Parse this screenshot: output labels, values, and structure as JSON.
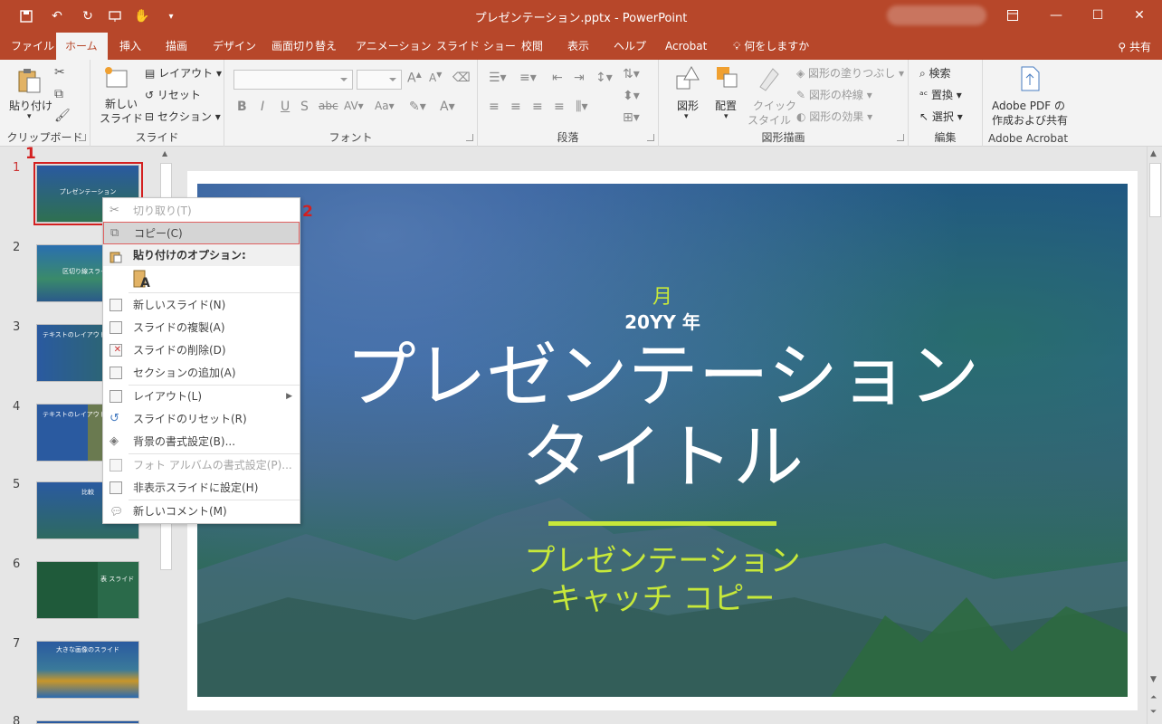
{
  "titlebar": {
    "title": "プレゼンテーション.pptx  -  PowerPoint",
    "quick_access": [
      "save-icon",
      "undo-icon",
      "redo-icon",
      "present-icon",
      "touch-mode-icon",
      "customize-icon"
    ],
    "window_buttons": [
      "ribbon-display-icon",
      "minimize-icon",
      "maximize-icon",
      "close-icon"
    ]
  },
  "tabs": {
    "items": [
      "ファイル",
      "ホーム",
      "挿入",
      "描画",
      "デザイン",
      "画面切り替え",
      "アニメーション",
      "スライド ショー",
      "校閲",
      "表示",
      "ヘルプ",
      "Acrobat"
    ],
    "active": "ホーム",
    "tell_me": "何をしますか",
    "share": "共有"
  },
  "ribbon": {
    "clipboard": {
      "label": "クリップボード",
      "paste": "貼り付け"
    },
    "slides": {
      "label": "スライド",
      "new_slide_1": "新しい",
      "new_slide_2": "スライド",
      "layout": "レイアウト",
      "reset": "リセット",
      "section": "セクション"
    },
    "font": {
      "label": "フォント",
      "bold": "B",
      "italic": "I",
      "underline": "U",
      "strike": "S",
      "shadow": "abc"
    },
    "paragraph": {
      "label": "段落"
    },
    "drawing": {
      "label": "図形描画",
      "shapes": "図形",
      "arrange": "配置",
      "quick_style_1": "クイック",
      "quick_style_2": "スタイル",
      "fill": "図形の塗りつぶし",
      "outline": "図形の枠線",
      "effect": "図形の効果"
    },
    "editing": {
      "label": "編集",
      "find": "検索",
      "replace": "置換",
      "select": "選択"
    },
    "acrobat": {
      "label": "Adobe Acrobat",
      "btn_1": "Adobe PDF の",
      "btn_2": "作成および共有"
    }
  },
  "thumbnails": [
    {
      "num": "1",
      "title": "プレゼンテーション"
    },
    {
      "num": "2",
      "title": "区切り線スライド"
    },
    {
      "num": "3",
      "title": "テキストのレイアウト 1"
    },
    {
      "num": "4",
      "title": "テキストのレイアウト 2"
    },
    {
      "num": "5",
      "title": "比較"
    },
    {
      "num": "6",
      "title": "表 スライド"
    },
    {
      "num": "7",
      "title": "大きな画像のスライド"
    },
    {
      "num": "8",
      "title": ""
    }
  ],
  "slide": {
    "month": "月",
    "year": "20YY 年",
    "title_line1": "プレゼンテーション",
    "title_line2": "タイトル",
    "sub_line1": "プレゼンテーション",
    "sub_line2": "キャッチ コピー"
  },
  "context_menu": {
    "cut": "切り取り(T)",
    "copy": "コピー(C)",
    "paste_header": "貼り付けのオプション:",
    "paste_keep": "A",
    "new_slide": "新しいスライド(N)",
    "duplicate": "スライドの複製(A)",
    "delete": "スライドの削除(D)",
    "add_section": "セクションの追加(A)",
    "layout": "レイアウト(L)",
    "reset": "スライドのリセット(R)",
    "format_bg": "背景の書式設定(B)...",
    "photo_album": "フォト アルバムの書式設定(P)...",
    "hide": "非表示スライドに設定(H)",
    "new_comment": "新しいコメント(M)"
  },
  "callouts": {
    "step1": "1",
    "step2": "2"
  }
}
